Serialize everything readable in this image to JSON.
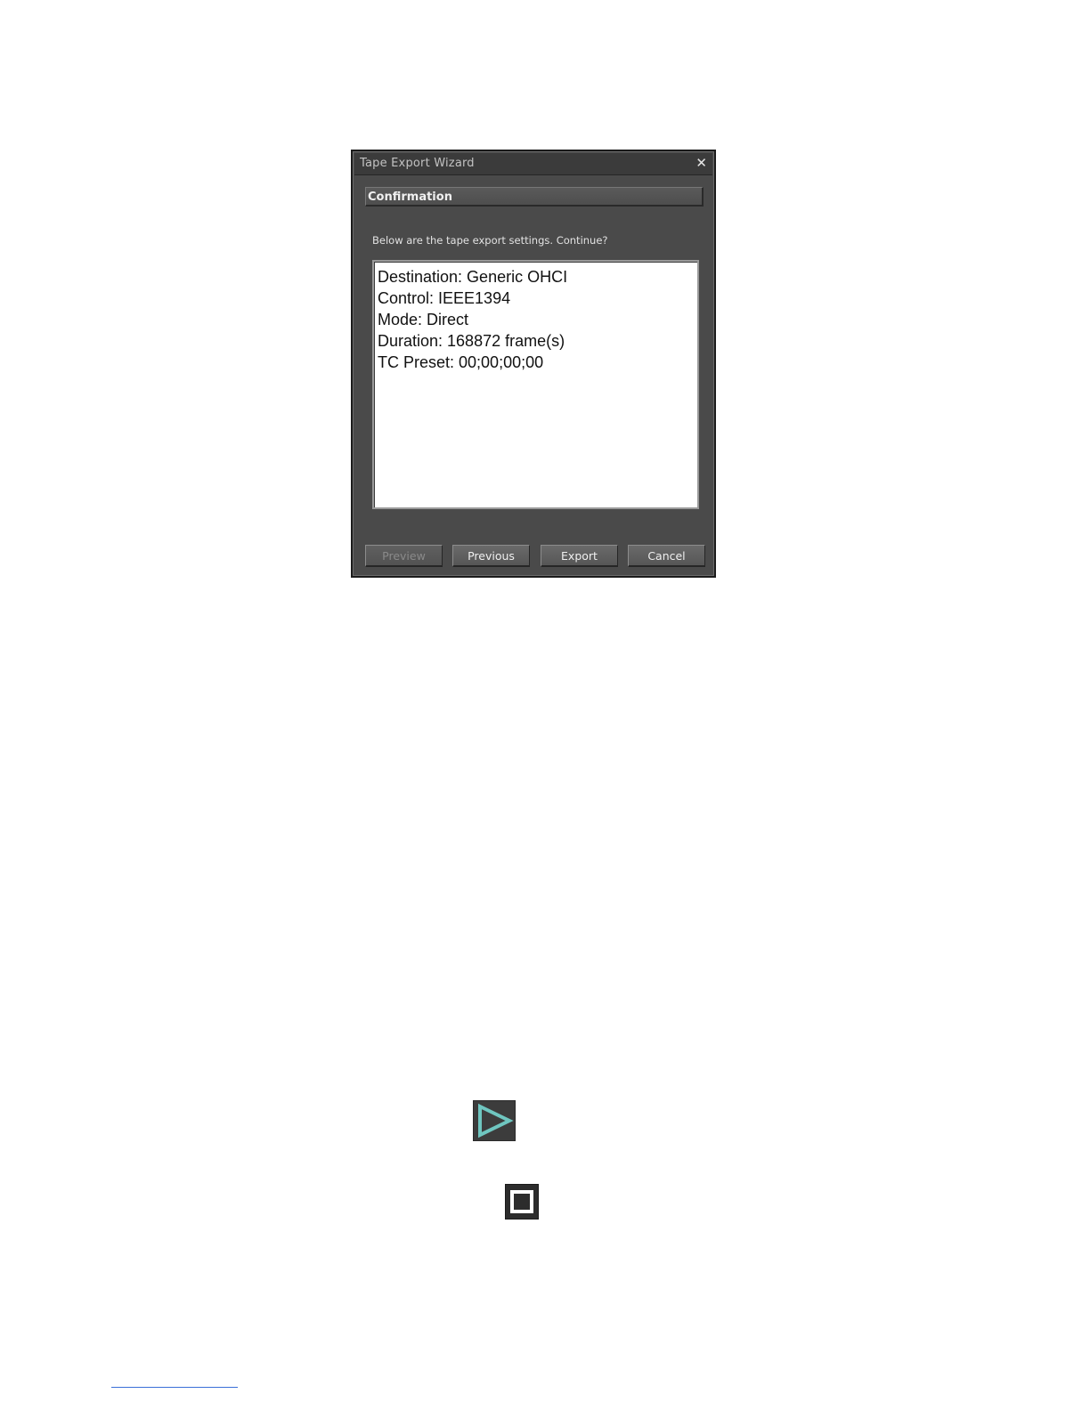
{
  "dialog": {
    "title": "Tape Export Wizard",
    "close_symbol": "✕",
    "section_header": "Confirmation",
    "prompt": "Below are the tape export settings. Continue?",
    "settings": [
      "Destination: Generic OHCI",
      "Control: IEEE1394",
      "Mode: Direct",
      "Duration: 168872 frame(s)",
      "TC Preset: 00;00;00;00"
    ],
    "buttons": {
      "preview": "Preview",
      "previous": "Previous",
      "export": "Export",
      "cancel": "Cancel"
    }
  },
  "icons": {
    "play": "play-icon",
    "stop": "stop-icon",
    "play_color": "#6fc6c0"
  }
}
